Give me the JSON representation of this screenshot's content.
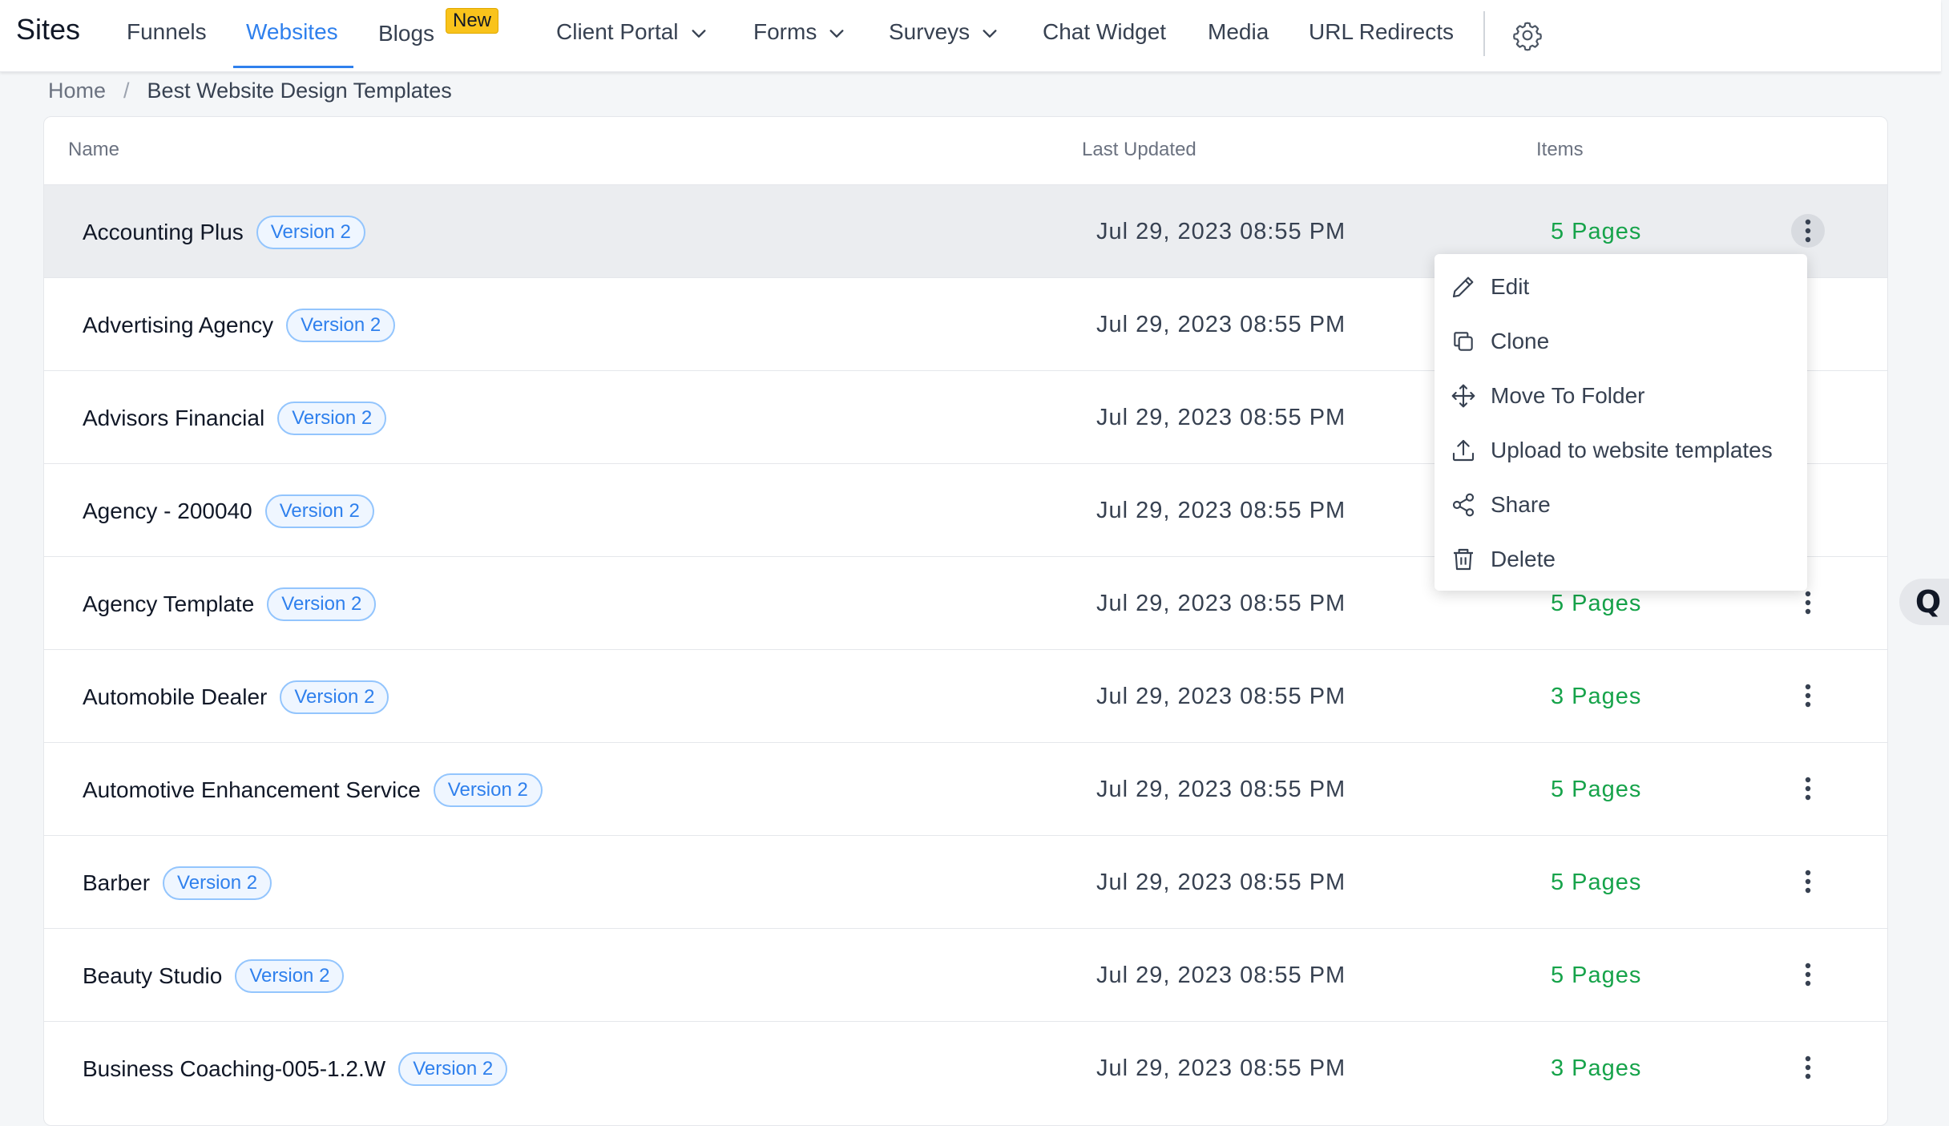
{
  "topnav": {
    "brand": "Sites",
    "items": [
      {
        "label": "Funnels"
      },
      {
        "label": "Websites"
      },
      {
        "label": "Blogs",
        "badge": "New"
      },
      {
        "label": "Client Portal"
      },
      {
        "label": "Forms"
      },
      {
        "label": "Surveys"
      },
      {
        "label": "Chat Widget"
      },
      {
        "label": "Media"
      },
      {
        "label": "URL Redirects"
      }
    ],
    "active": "Websites",
    "settings_icon": "gear-icon"
  },
  "breadcrumb": {
    "home": "Home",
    "separator": "/",
    "current": "Best Website Design Templates"
  },
  "table": {
    "columns": [
      "Name",
      "Last Updated",
      "Items"
    ],
    "rows": [
      {
        "name": "Accounting Plus",
        "version": "Version 2",
        "updated": "Jul 29, 2023 08:55 PM",
        "items": "5 Pages"
      },
      {
        "name": "Advertising Agency",
        "version": "Version 2",
        "updated": "Jul 29, 2023 08:55 PM",
        "items": ""
      },
      {
        "name": "Advisors Financial",
        "version": "Version 2",
        "updated": "Jul 29, 2023 08:55 PM",
        "items": ""
      },
      {
        "name": "Agency - 200040",
        "version": "Version 2",
        "updated": "Jul 29, 2023 08:55 PM",
        "items": ""
      },
      {
        "name": "Agency Template",
        "version": "Version 2",
        "updated": "Jul 29, 2023 08:55 PM",
        "items": "5 Pages"
      },
      {
        "name": "Automobile Dealer",
        "version": "Version 2",
        "updated": "Jul 29, 2023 08:55 PM",
        "items": "3 Pages"
      },
      {
        "name": "Automotive Enhancement Service",
        "version": "Version 2",
        "updated": "Jul 29, 2023 08:55 PM",
        "items": "5 Pages"
      },
      {
        "name": "Barber",
        "version": "Version 2",
        "updated": "Jul 29, 2023 08:55 PM",
        "items": "5 Pages"
      },
      {
        "name": "Beauty Studio",
        "version": "Version 2",
        "updated": "Jul 29, 2023 08:55 PM",
        "items": "5 Pages"
      },
      {
        "name": "Business Coaching-005-1.2.W",
        "version": "Version 2",
        "updated": "Jul 29, 2023 08:55 PM",
        "items": "3 Pages"
      }
    ]
  },
  "context_menu": {
    "items": [
      {
        "label": "Edit",
        "icon": "pencil-icon"
      },
      {
        "label": "Clone",
        "icon": "copy-icon"
      },
      {
        "label": "Move To Folder",
        "icon": "move-icon"
      },
      {
        "label": "Upload to website templates",
        "icon": "upload-icon"
      },
      {
        "label": "Share",
        "icon": "share-icon"
      },
      {
        "label": "Delete",
        "icon": "trash-icon"
      }
    ]
  },
  "side_widget": {
    "label": "Q"
  },
  "colors": {
    "accent": "#2f80ed",
    "pages_green": "#16a34a",
    "badge_yellow": "#f9c31b",
    "row_hover": "#ebedf0"
  }
}
